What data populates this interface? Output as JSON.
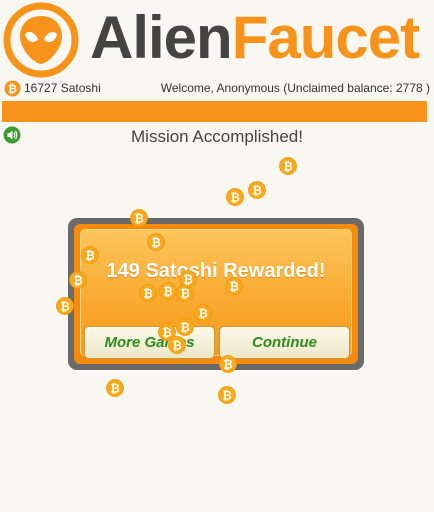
{
  "logo": {
    "word1": "Alien",
    "word2": "Faucet",
    "icon": "alien-head-icon"
  },
  "status": {
    "balance_icon": "bitcoin-icon",
    "balance": "16727 Satoshi",
    "welcome": "Welcome, Anonymous (Unclaimed balance: 2778 )",
    "progress": 1.0
  },
  "sound": {
    "icon": "speaker-icon"
  },
  "mission": {
    "text": "Mission Accomplished!"
  },
  "dialog": {
    "title": "149 Satoshi Rewarded!",
    "more_games": "More Games",
    "continue": "Continue"
  },
  "coin_glyph": "₿",
  "colors": {
    "accent_orange": "#f7931a",
    "logo_gray": "#444444",
    "button_text_green": "#2e8b1e",
    "sound_green": "#3c9a2e"
  }
}
